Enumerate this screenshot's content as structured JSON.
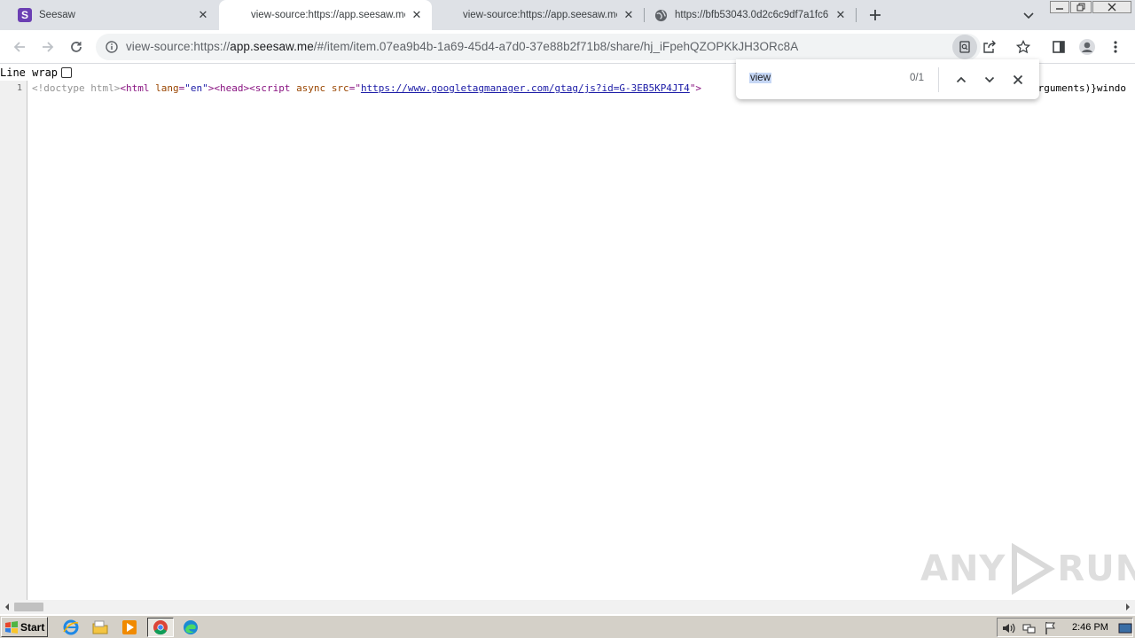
{
  "tabs": [
    {
      "title": "Seesaw",
      "favicon": "seesaw-s-icon",
      "active": false
    },
    {
      "title": "view-source:https://app.seesaw.me",
      "active": true
    },
    {
      "title": "view-source:https://app.seesaw.me",
      "active": false
    },
    {
      "title": "https://bfb53043.0d2c6c9df7a1fc6",
      "favicon": "globe-icon",
      "active": false
    }
  ],
  "toolbar": {
    "url_prefix": "view-source:https://",
    "url_domain": "app.seesaw.me",
    "url_path": "/#/item/item.07ea9b4b-1a69-45d4-a7d0-37e88b2f71b8/share/hj_iFpehQZOPKkJH3ORc8A"
  },
  "viewer": {
    "line_wrap_label": "Line wrap",
    "line_number": "1",
    "code": {
      "doctype": "<!doctype html>",
      "html_open": "<html ",
      "lang_attr": "lang",
      "eq1": "=",
      "lang_val": "\"en\"",
      "head_and_script": "><head><script ",
      "async_attr": "async ",
      "src_attr": "src",
      "eq2": "=",
      "quote_open": "\"",
      "src_url": "https://www.googletagmanager.com/gtag/js?id=G-3EB5KP4JT4",
      "quote_close": "\">",
      "tail": "arguments)}windo"
    }
  },
  "findbar": {
    "query": "view",
    "count": "0/1"
  },
  "watermark": {
    "text_left": "ANY",
    "text_right": "RUN"
  },
  "taskbar": {
    "start_label": "Start",
    "clock": "2:46 PM"
  },
  "colors": {
    "tabstrip_bg": "#dee1e6",
    "seesaw_brand": "#6b3fb3",
    "selection_highlight": "#c6d7f5"
  }
}
